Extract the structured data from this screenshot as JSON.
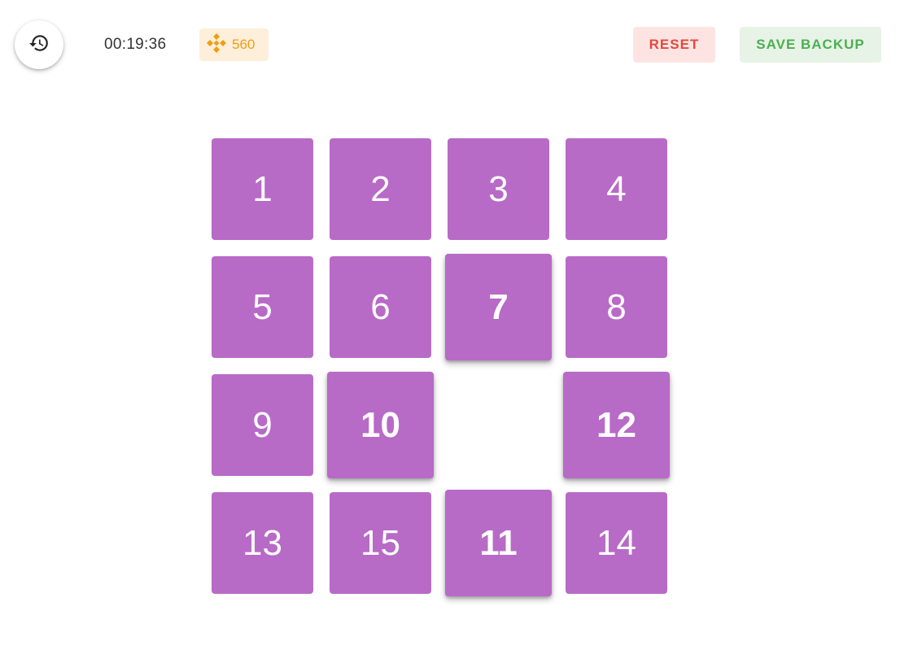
{
  "header": {
    "history_icon": "history-icon",
    "timer": "00:19:36",
    "coins": {
      "icon": "binance-coin-icon",
      "value": "560",
      "color": "#f39c12"
    },
    "reset_label": "RESET",
    "save_backup_label": "SAVE BACKUP"
  },
  "colors": {
    "tile": "#b86ac7",
    "reset_bg": "#fde4e3",
    "reset_text": "#e04a3c",
    "save_bg": "#e6f3e6",
    "save_text": "#4caf50"
  },
  "board": {
    "rows": 4,
    "cols": 4,
    "cells": [
      [
        "1",
        "2",
        "3",
        "4"
      ],
      [
        "5",
        "6",
        "7",
        "8"
      ],
      [
        "9",
        "10",
        "",
        "12"
      ],
      [
        "13",
        "15",
        "11",
        "14"
      ]
    ],
    "movable_tiles": [
      "7",
      "10",
      "12",
      "11"
    ]
  }
}
